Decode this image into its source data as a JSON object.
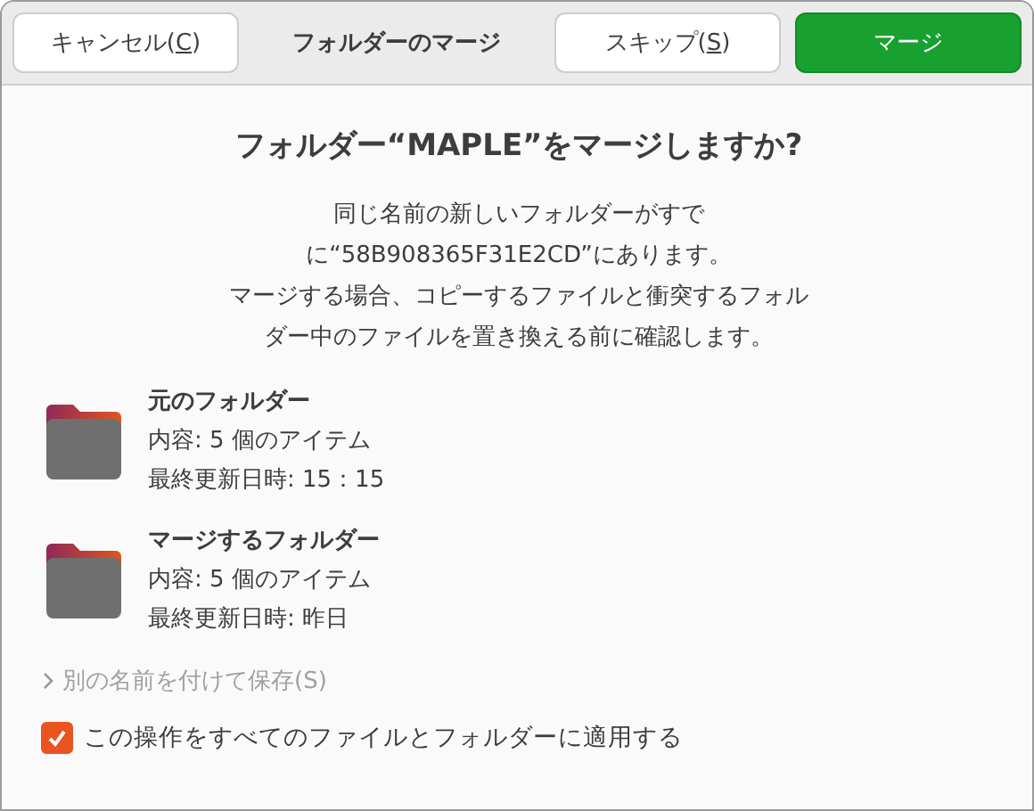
{
  "header": {
    "title": "フォルダーのマージ",
    "cancel": {
      "before": "キャンセル(",
      "mnemonic": "C",
      "after": ")"
    },
    "skip": {
      "before": "スキップ(",
      "mnemonic": "S",
      "after": ")"
    },
    "merge": {
      "label": "マージ"
    }
  },
  "heading": "フォルダー“MAPLE”をマージしますか?",
  "message": [
    "同じ名前の新しいフォルダーがすで",
    "に“58B908365F31E2CD”にあります。",
    "マージする場合、コピーするファイルと衝突するフォル",
    "ダー中のファイルを置き換える前に確認します。"
  ],
  "folders": [
    {
      "title": "元のフォルダー",
      "contents": "内容: 5 個のアイテム",
      "modified": "最終更新日時: 15：15"
    },
    {
      "title": "マージするフォルダー",
      "contents": "内容: 5 個のアイテム",
      "modified": "最終更新日時: 昨日"
    }
  ],
  "save_as": {
    "label": "別の名前を付けて保存(S)",
    "expanded": false
  },
  "apply_all": {
    "label": "この操作をすべてのファイルとフォルダーに適用する",
    "checked": true
  }
}
